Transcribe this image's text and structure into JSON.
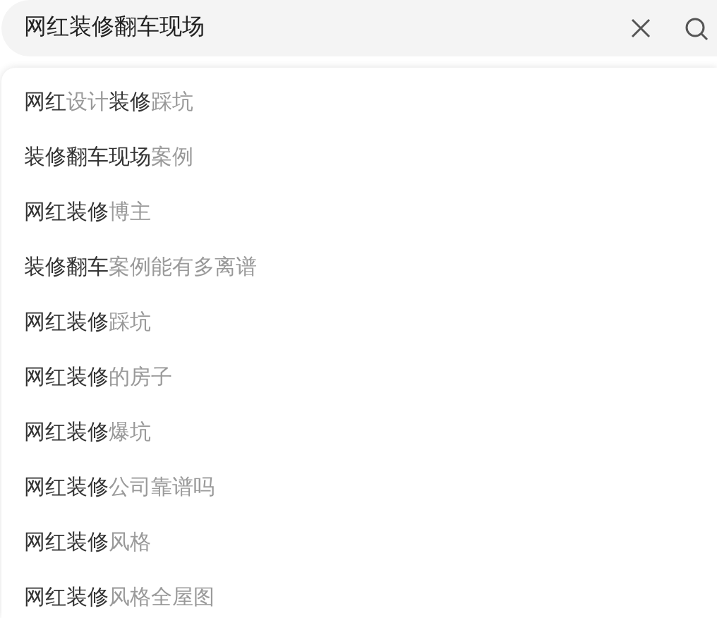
{
  "search": {
    "value": "网红装修翻车现场"
  },
  "suggestions": [
    {
      "parts": [
        {
          "text": "网红",
          "matched": true
        },
        {
          "text": "设计",
          "matched": false
        },
        {
          "text": "装修",
          "matched": true
        },
        {
          "text": "踩坑",
          "matched": false
        }
      ]
    },
    {
      "parts": [
        {
          "text": "装修翻车现场",
          "matched": true
        },
        {
          "text": "案例",
          "matched": false
        }
      ]
    },
    {
      "parts": [
        {
          "text": "网红装修",
          "matched": true
        },
        {
          "text": "博主",
          "matched": false
        }
      ]
    },
    {
      "parts": [
        {
          "text": "装修翻车",
          "matched": true
        },
        {
          "text": "案例能有多离谱",
          "matched": false
        }
      ]
    },
    {
      "parts": [
        {
          "text": "网红装修",
          "matched": true
        },
        {
          "text": "踩坑",
          "matched": false
        }
      ]
    },
    {
      "parts": [
        {
          "text": "网红装修",
          "matched": true
        },
        {
          "text": "的房子",
          "matched": false
        }
      ]
    },
    {
      "parts": [
        {
          "text": "网红装修",
          "matched": true
        },
        {
          "text": "爆坑",
          "matched": false
        }
      ]
    },
    {
      "parts": [
        {
          "text": "网红装修",
          "matched": true
        },
        {
          "text": "公司靠谱吗",
          "matched": false
        }
      ]
    },
    {
      "parts": [
        {
          "text": "网红装修",
          "matched": true
        },
        {
          "text": "风格",
          "matched": false
        }
      ]
    },
    {
      "parts": [
        {
          "text": "网红装修",
          "matched": true
        },
        {
          "text": "风格全屋图",
          "matched": false
        }
      ]
    }
  ]
}
